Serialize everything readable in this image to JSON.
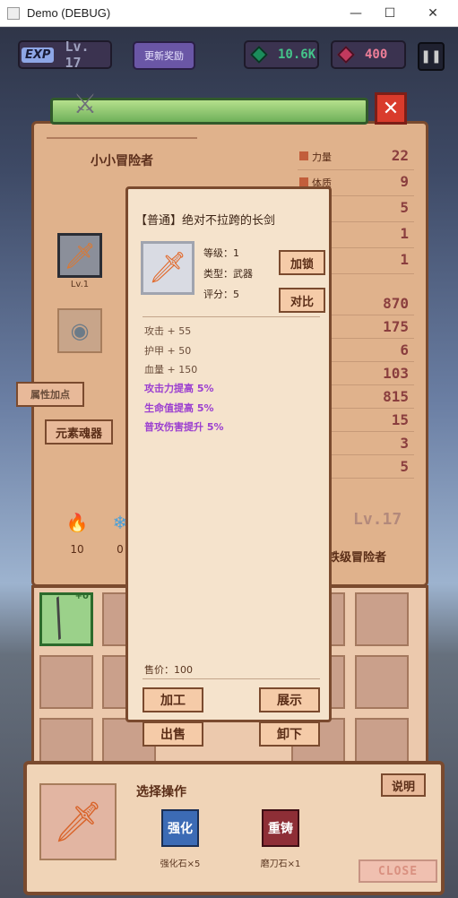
{
  "window": {
    "title": "Demo (DEBUG)"
  },
  "hud": {
    "exp_tag": "EXP",
    "level": "Lv. 17",
    "reward_button": "更新奖励",
    "green_gems": "10.6K",
    "red_gems": "400"
  },
  "hero": {
    "name": "小小冒险者",
    "equip_level": "Lv.1",
    "attr_button": "属性加点",
    "soul_button": "元素魂器",
    "stats_top": [
      {
        "label": "力量",
        "value": "22"
      },
      {
        "label": "体质",
        "value": "9"
      },
      {
        "label": "",
        "value": "5"
      },
      {
        "label": "",
        "value": "1"
      },
      {
        "label": "",
        "value": "1"
      }
    ],
    "stats_bottom": [
      "870",
      "175",
      "6",
      "103",
      "815",
      "15",
      "3",
      "5"
    ],
    "resources": [
      {
        "name": "fire",
        "count": "10"
      },
      {
        "name": "water",
        "count": "0"
      }
    ],
    "big_level": "Lv.17",
    "title_badge": "铁级冒险者"
  },
  "inventory": {
    "equipped_badge": "+0"
  },
  "item_detail": {
    "title": "【普通】绝对不拉跨的长剑",
    "level": "等级：1",
    "type": "类型：武器",
    "score": "评分：5",
    "lock_button": "加锁",
    "compare_button": "对比",
    "attrs": [
      {
        "text": "攻击 + 55",
        "highlight": false
      },
      {
        "text": "护甲 + 50",
        "highlight": false
      },
      {
        "text": "血量 + 150",
        "highlight": false
      },
      {
        "text": "攻击力提高 5%",
        "highlight": true
      },
      {
        "text": "生命值提高 5%",
        "highlight": true
      },
      {
        "text": "普攻伤害提升 5%",
        "highlight": true
      }
    ],
    "price": "售价：100",
    "process_button": "加工",
    "display_button": "展示",
    "sell_button": "出售",
    "unequip_button": "卸下"
  },
  "operation": {
    "title": "选择操作",
    "help_button": "说明",
    "enhance_label": "强化",
    "enhance_cost": "强化石×5",
    "reforge_label": "重铸",
    "reforge_cost": "磨刀石×1",
    "close_button": "CLOSE"
  },
  "colors": {
    "panel_bg": "#e0b28c",
    "panel_border": "#7a4a2e",
    "highlight_attr": "#9b3fd0"
  }
}
